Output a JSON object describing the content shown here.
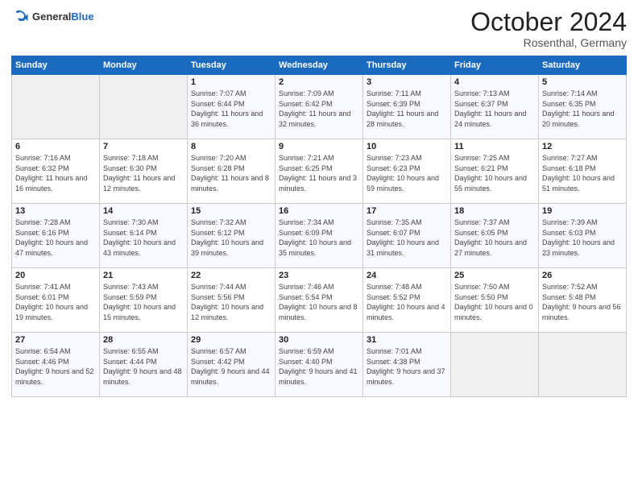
{
  "header": {
    "logo_general": "General",
    "logo_blue": "Blue",
    "month": "October 2024",
    "location": "Rosenthal, Germany"
  },
  "weekdays": [
    "Sunday",
    "Monday",
    "Tuesday",
    "Wednesday",
    "Thursday",
    "Friday",
    "Saturday"
  ],
  "weeks": [
    [
      {
        "day": "",
        "info": ""
      },
      {
        "day": "",
        "info": ""
      },
      {
        "day": "1",
        "info": "Sunrise: 7:07 AM\nSunset: 6:44 PM\nDaylight: 11 hours and 36 minutes."
      },
      {
        "day": "2",
        "info": "Sunrise: 7:09 AM\nSunset: 6:42 PM\nDaylight: 11 hours and 32 minutes."
      },
      {
        "day": "3",
        "info": "Sunrise: 7:11 AM\nSunset: 6:39 PM\nDaylight: 11 hours and 28 minutes."
      },
      {
        "day": "4",
        "info": "Sunrise: 7:13 AM\nSunset: 6:37 PM\nDaylight: 11 hours and 24 minutes."
      },
      {
        "day": "5",
        "info": "Sunrise: 7:14 AM\nSunset: 6:35 PM\nDaylight: 11 hours and 20 minutes."
      }
    ],
    [
      {
        "day": "6",
        "info": "Sunrise: 7:16 AM\nSunset: 6:32 PM\nDaylight: 11 hours and 16 minutes."
      },
      {
        "day": "7",
        "info": "Sunrise: 7:18 AM\nSunset: 6:30 PM\nDaylight: 11 hours and 12 minutes."
      },
      {
        "day": "8",
        "info": "Sunrise: 7:20 AM\nSunset: 6:28 PM\nDaylight: 11 hours and 8 minutes."
      },
      {
        "day": "9",
        "info": "Sunrise: 7:21 AM\nSunset: 6:25 PM\nDaylight: 11 hours and 3 minutes."
      },
      {
        "day": "10",
        "info": "Sunrise: 7:23 AM\nSunset: 6:23 PM\nDaylight: 10 hours and 59 minutes."
      },
      {
        "day": "11",
        "info": "Sunrise: 7:25 AM\nSunset: 6:21 PM\nDaylight: 10 hours and 55 minutes."
      },
      {
        "day": "12",
        "info": "Sunrise: 7:27 AM\nSunset: 6:18 PM\nDaylight: 10 hours and 51 minutes."
      }
    ],
    [
      {
        "day": "13",
        "info": "Sunrise: 7:28 AM\nSunset: 6:16 PM\nDaylight: 10 hours and 47 minutes."
      },
      {
        "day": "14",
        "info": "Sunrise: 7:30 AM\nSunset: 6:14 PM\nDaylight: 10 hours and 43 minutes."
      },
      {
        "day": "15",
        "info": "Sunrise: 7:32 AM\nSunset: 6:12 PM\nDaylight: 10 hours and 39 minutes."
      },
      {
        "day": "16",
        "info": "Sunrise: 7:34 AM\nSunset: 6:09 PM\nDaylight: 10 hours and 35 minutes."
      },
      {
        "day": "17",
        "info": "Sunrise: 7:35 AM\nSunset: 6:07 PM\nDaylight: 10 hours and 31 minutes."
      },
      {
        "day": "18",
        "info": "Sunrise: 7:37 AM\nSunset: 6:05 PM\nDaylight: 10 hours and 27 minutes."
      },
      {
        "day": "19",
        "info": "Sunrise: 7:39 AM\nSunset: 6:03 PM\nDaylight: 10 hours and 23 minutes."
      }
    ],
    [
      {
        "day": "20",
        "info": "Sunrise: 7:41 AM\nSunset: 6:01 PM\nDaylight: 10 hours and 19 minutes."
      },
      {
        "day": "21",
        "info": "Sunrise: 7:43 AM\nSunset: 5:59 PM\nDaylight: 10 hours and 15 minutes."
      },
      {
        "day": "22",
        "info": "Sunrise: 7:44 AM\nSunset: 5:56 PM\nDaylight: 10 hours and 12 minutes."
      },
      {
        "day": "23",
        "info": "Sunrise: 7:46 AM\nSunset: 5:54 PM\nDaylight: 10 hours and 8 minutes."
      },
      {
        "day": "24",
        "info": "Sunrise: 7:48 AM\nSunset: 5:52 PM\nDaylight: 10 hours and 4 minutes."
      },
      {
        "day": "25",
        "info": "Sunrise: 7:50 AM\nSunset: 5:50 PM\nDaylight: 10 hours and 0 minutes."
      },
      {
        "day": "26",
        "info": "Sunrise: 7:52 AM\nSunset: 5:48 PM\nDaylight: 9 hours and 56 minutes."
      }
    ],
    [
      {
        "day": "27",
        "info": "Sunrise: 6:54 AM\nSunset: 4:46 PM\nDaylight: 9 hours and 52 minutes."
      },
      {
        "day": "28",
        "info": "Sunrise: 6:55 AM\nSunset: 4:44 PM\nDaylight: 9 hours and 48 minutes."
      },
      {
        "day": "29",
        "info": "Sunrise: 6:57 AM\nSunset: 4:42 PM\nDaylight: 9 hours and 44 minutes."
      },
      {
        "day": "30",
        "info": "Sunrise: 6:59 AM\nSunset: 4:40 PM\nDaylight: 9 hours and 41 minutes."
      },
      {
        "day": "31",
        "info": "Sunrise: 7:01 AM\nSunset: 4:38 PM\nDaylight: 9 hours and 37 minutes."
      },
      {
        "day": "",
        "info": ""
      },
      {
        "day": "",
        "info": ""
      }
    ]
  ]
}
